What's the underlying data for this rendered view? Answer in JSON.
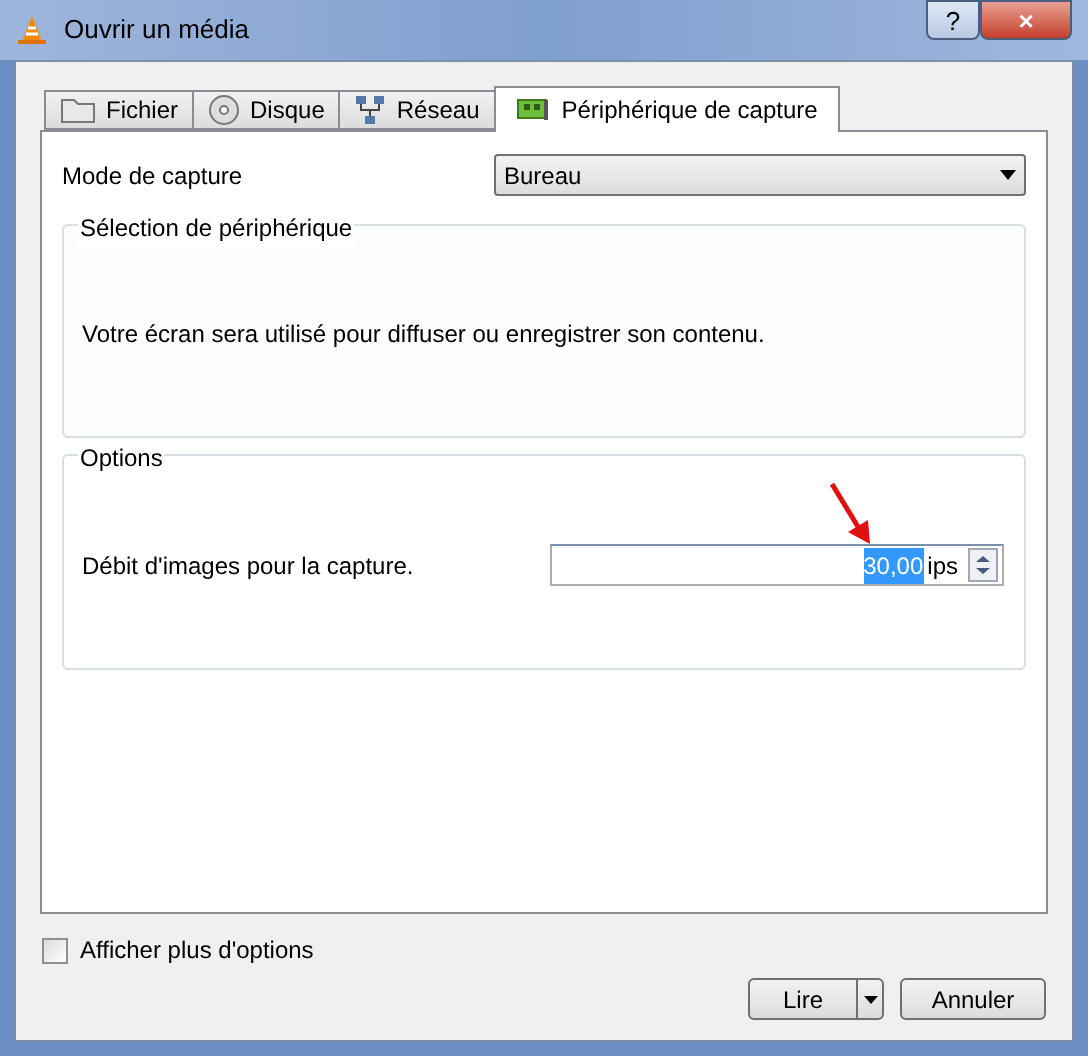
{
  "window": {
    "title": "Ouvrir un média",
    "buttons": [
      "?",
      "×"
    ]
  },
  "tabs": [
    {
      "label": "Fichier",
      "kind": "folder",
      "selected": false
    },
    {
      "label": "Disque",
      "kind": "disc",
      "selected": false
    },
    {
      "label": "Réseau",
      "kind": "network",
      "selected": false
    },
    {
      "label": "Périphérique de capture",
      "kind": "card",
      "selected": true
    }
  ],
  "capture_mode": {
    "label": "Mode de capture",
    "value": "Bureau"
  },
  "device_group": {
    "title": "Sélection de périphérique",
    "text": "Votre écran sera utilisé pour diffuser ou enregistrer son contenu."
  },
  "options_group": {
    "title": "Options",
    "frame_rate": {
      "label": "Débit d'images pour la capture.",
      "value": "30,00",
      "unit": "ips",
      "highlighted": true
    }
  },
  "more_options": {
    "label": "Afficher plus d'options",
    "checked": false
  },
  "buttons": [
    {
      "label": "Lire",
      "kind": "split"
    },
    {
      "label": "Annuler",
      "kind": "plain"
    }
  ]
}
